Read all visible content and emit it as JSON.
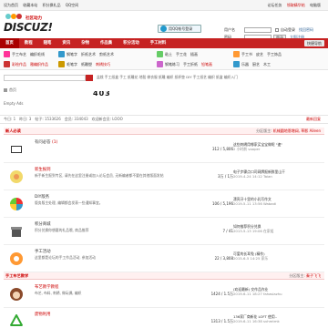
{
  "topbar": {
    "links": [
      "设为首页",
      "收藏本站",
      "积分换礼品",
      "QQ空间"
    ],
    "right": [
      "论坛任务",
      "领取精华帖",
      "电脑版"
    ]
  },
  "header": {
    "logo_sub": "社区动力",
    "logo_main": "DISCUZ!",
    "qq_login": "用QQ帐号登录",
    "login": {
      "user_label": "用户名",
      "pass_label": "密码",
      "remember": "自动登录",
      "login_btn": "登录",
      "forgot": "找回密码",
      "register": "立即注册"
    }
  },
  "nav": {
    "items": [
      "首页",
      "教程",
      "随笔",
      "资讯",
      "杂物",
      "作品集",
      "积分活动",
      "手工材料"
    ],
    "quick": "快捷导航"
  },
  "subnav": {
    "col1": [
      "手工布艺",
      "彩绘作品",
      "手工布艺"
    ],
    "col1b": [
      "编织毛线",
      "雅编织作品",
      "印染作品"
    ],
    "col2": [
      "钢笔字",
      "毛笔字",
      "钢笔练习"
    ],
    "col3": [
      "折纸艺术",
      "纸雕塑",
      "手工折纸"
    ],
    "col4": [
      "剪纸艺术",
      "刺绣技巧",
      "铅笔画"
    ],
    "col5": [
      "粘土",
      "手工花",
      "插画"
    ],
    "col6": [
      "手工书",
      "皮艺",
      "手工饰品"
    ],
    "col6b": [
      "乐器",
      "厨艺",
      "木工"
    ]
  },
  "search": {
    "hot_label": "热搜: diy纸杯垫 盆栽",
    "hot": "盆栽 手工纸盒 手工 纸雕花 地毯 做衣服 纸雕 编织 纸杯垫 DIY 手工纸艺 编织 纸盒 编织入门"
  },
  "crumb": "首页",
  "ticker": "403",
  "ads": "Empty Ads",
  "stats": {
    "today": "今日: 1",
    "yesterday": "昨日: 3",
    "posts": "帖子: 1533626",
    "members": "会员: 334043",
    "newest": "欢迎新会员: LOOO",
    "right": "最新回复"
  },
  "sections": [
    {
      "title": "新人必读",
      "mods": "分区版主: ",
      "mod_name": "机械圆地恩增阔, 草影 Aileen"
    },
    {
      "title": "手工布艺教学",
      "mods": "分区版主: ",
      "mod_name": "秦子飞飞"
    }
  ],
  "forums": [
    {
      "name": "有问必答",
      "extra": "(1)",
      "desc": "",
      "count": "312 / 5,806",
      "last_title": "这些刺绣用哪家买宝宝做呢 \"速\"",
      "last_time": "2 小时前 vooper"
    },
    {
      "name": "新生报到",
      "extra": "",
      "desc": "新手新生报到专区, 请先在这里注册或加入论坛会员, 无新编者都不要在其他版面发帖",
      "count": "3万 / 1万",
      "last_title": "电子步骤点口司网牌报新鲜里山干",
      "last_time": "2019-4-24 14:12 Taian"
    },
    {
      "name": "DIY版务",
      "extra": "",
      "desc": "版务版主处理, 编辑都会发表一些通知事宜。",
      "count": "106 / 5,196",
      "last_title": "漂亮牙十里的小乳写作文",
      "last_time": "2019-5-11 13:56 Wabadi"
    },
    {
      "name": "积分商城",
      "extra": "",
      "desc": "积分兑换你想要的礼品哦, 商品推荐",
      "count": "7 / 41",
      "last_title": "如何推荐积分兑换",
      "last_time": "2013-5-13 19:06 在家组"
    },
    {
      "name": "手工活动",
      "extra": "",
      "desc": "这里都是论坛的手工作品活动, 参加活动",
      "count": "22 / 3,808",
      "last_title": "可爱的长耳兔 (精作)",
      "last_time": "2015-6-5 14:25 家乐"
    },
    {
      "name": "布艺教学教程",
      "extra": "",
      "desc": "布艺, 布料, 刺绣, 做玩偶, 编织",
      "count": "1424 / 1.5万",
      "last_title": "(欢迎最新) 交作品作业",
      "last_time": "2019-6-11 18:27 fahasiazhu"
    },
    {
      "name": "废物利用",
      "extra": "",
      "desc": "",
      "count": "1313 / 1.5万",
      "last_title": "136家厂商新花 LOFT 使用..",
      "last_time": "2019-6-11 16:38 svhmtmk"
    }
  ],
  "colors": {
    "brand": "#c62222",
    "link": "#cc0000"
  }
}
